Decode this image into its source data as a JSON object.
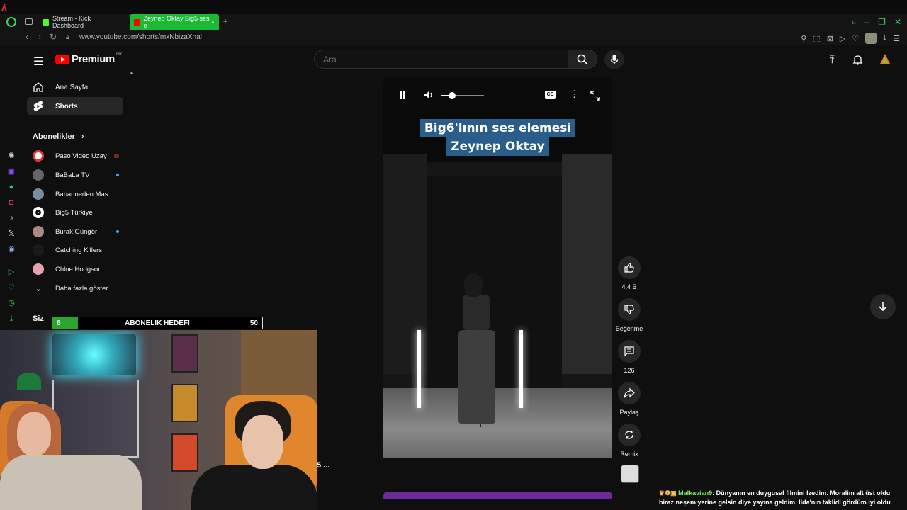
{
  "browser": {
    "tabs": [
      {
        "label": "Stream - Kick Dashboard",
        "favicon_color": "#53fc18"
      },
      {
        "label": "Zeynep Oktay Big5 ses e",
        "favicon_color": "#ff0000",
        "active": true
      }
    ],
    "url": "www.youtube.com/shorts/mxNbizaXnal",
    "accent_color": "#1bb934"
  },
  "masthead": {
    "brand": "Premium",
    "region": "TR",
    "search_placeholder": "Ara"
  },
  "sidebar": {
    "nav": [
      {
        "label": "Ana Sayfa",
        "icon": "home-icon"
      },
      {
        "label": "Shorts",
        "icon": "shorts-icon",
        "active": true
      }
    ],
    "subscriptions_header": "Abonelikler",
    "subscriptions": [
      {
        "name": "Paso Video Uzay",
        "avatar_color": "#e33",
        "indicator": "live"
      },
      {
        "name": "BaBaLa TV",
        "avatar_color": "#555",
        "indicator": "new"
      },
      {
        "name": "Babanneden Masallar",
        "avatar_color": "#7a8c9a",
        "indicator": "none"
      },
      {
        "name": "Big5 Türkiye",
        "avatar_color": "#fff",
        "indicator": "none"
      },
      {
        "name": "Burak Güngör",
        "avatar_color": "#a88",
        "indicator": "new"
      },
      {
        "name": "Catching Killers",
        "avatar_color": "#222",
        "indicator": "none"
      },
      {
        "name": "Chloe Hodgson",
        "avatar_color": "#e9a0b0",
        "indicator": "none"
      }
    ],
    "show_more": "Daha fazla göster",
    "you_header": "Siz"
  },
  "goal": {
    "current": "6",
    "title": "ABONELIK HEDEFI",
    "target": "50",
    "progress": 0.12
  },
  "player": {
    "caption_line1": "Big6'lının ses elemesi",
    "caption_line2": "Zeynep Oktay",
    "volume": 0.25
  },
  "actions": {
    "likes": "4,4 B",
    "dislike": "Beğenme",
    "comments": "126",
    "share": "Paylaş",
    "remix": "Remix"
  },
  "stream_fragment": "5 ...",
  "chat": {
    "username": "Malkavian9",
    "message": ": Dünyanın en duygusal filmini Izedim. Moralim alt üst oldu biraz neşem yerine gelsin diye yayına geldim. İlda'nın taklidi gördüm iyi oldu"
  }
}
